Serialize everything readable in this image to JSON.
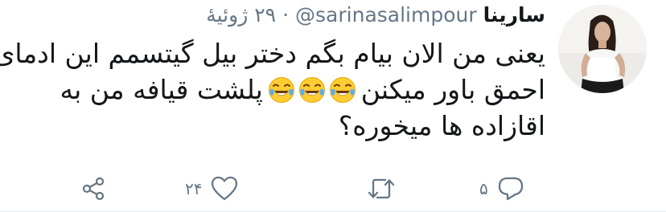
{
  "tweet": {
    "display_name": "سارینا",
    "handle": "@sarinasalimpour",
    "separator": "·",
    "date": "۲۹ ژوئیهٔ",
    "lines": [
      "یعنی من الان بیام بگم دختر بیل گیتسمم این ادمای",
      "پلشت قیافه من به",
      "احمق باور میکنن",
      "اقازاده ها میخوره؟"
    ],
    "emoji": [
      "face-with-tears-of-joy-icon",
      "face-with-tears-of-joy-icon",
      "face-with-tears-of-joy-icon"
    ]
  },
  "actions": {
    "reply_count": "۵",
    "retweet_count": "",
    "like_count": "۲۴"
  },
  "colors": {
    "text": "#14171a",
    "muted": "#657786",
    "emoji_yellow": "#ffcc33",
    "emoji_tears": "#5dadec"
  }
}
